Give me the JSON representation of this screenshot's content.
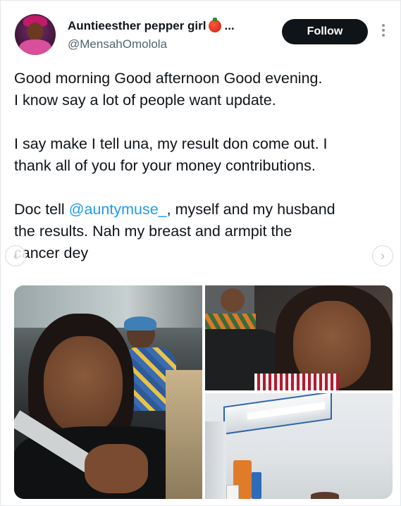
{
  "user": {
    "display_name": "Auntieesther pepper girl",
    "name_emoji": "tomato-icon",
    "truncation": "...",
    "handle": "@MensahOmolola"
  },
  "follow_button": {
    "label": "Follow"
  },
  "tweet": {
    "paragraph_1_line_1": "Good morning Good afternoon Good evening.",
    "paragraph_1_line_2": "I know say a lot of people want update.",
    "paragraph_2_line_1": "I say make I tell una, my result don come out. I",
    "paragraph_2_line_2": "thank all of you for your money contributions.",
    "paragraph_3_prefix": "Doc tell ",
    "paragraph_3_mention": "@auntymuse_",
    "paragraph_3_rest_line_1": ", myself and my husband",
    "paragraph_3_line_2": "the results. Nah my breast and armpit the",
    "paragraph_3_line_3": "cancer dey"
  },
  "colors": {
    "mention": "#1d9bf0",
    "follow_bg": "#0f1419",
    "handle": "#536471"
  },
  "media": {
    "photos": [
      {
        "label": "woman-in-car-selfie-photo"
      },
      {
        "label": "woman-selfie-close-up-photo"
      },
      {
        "label": "hospital-room-photo"
      }
    ]
  }
}
